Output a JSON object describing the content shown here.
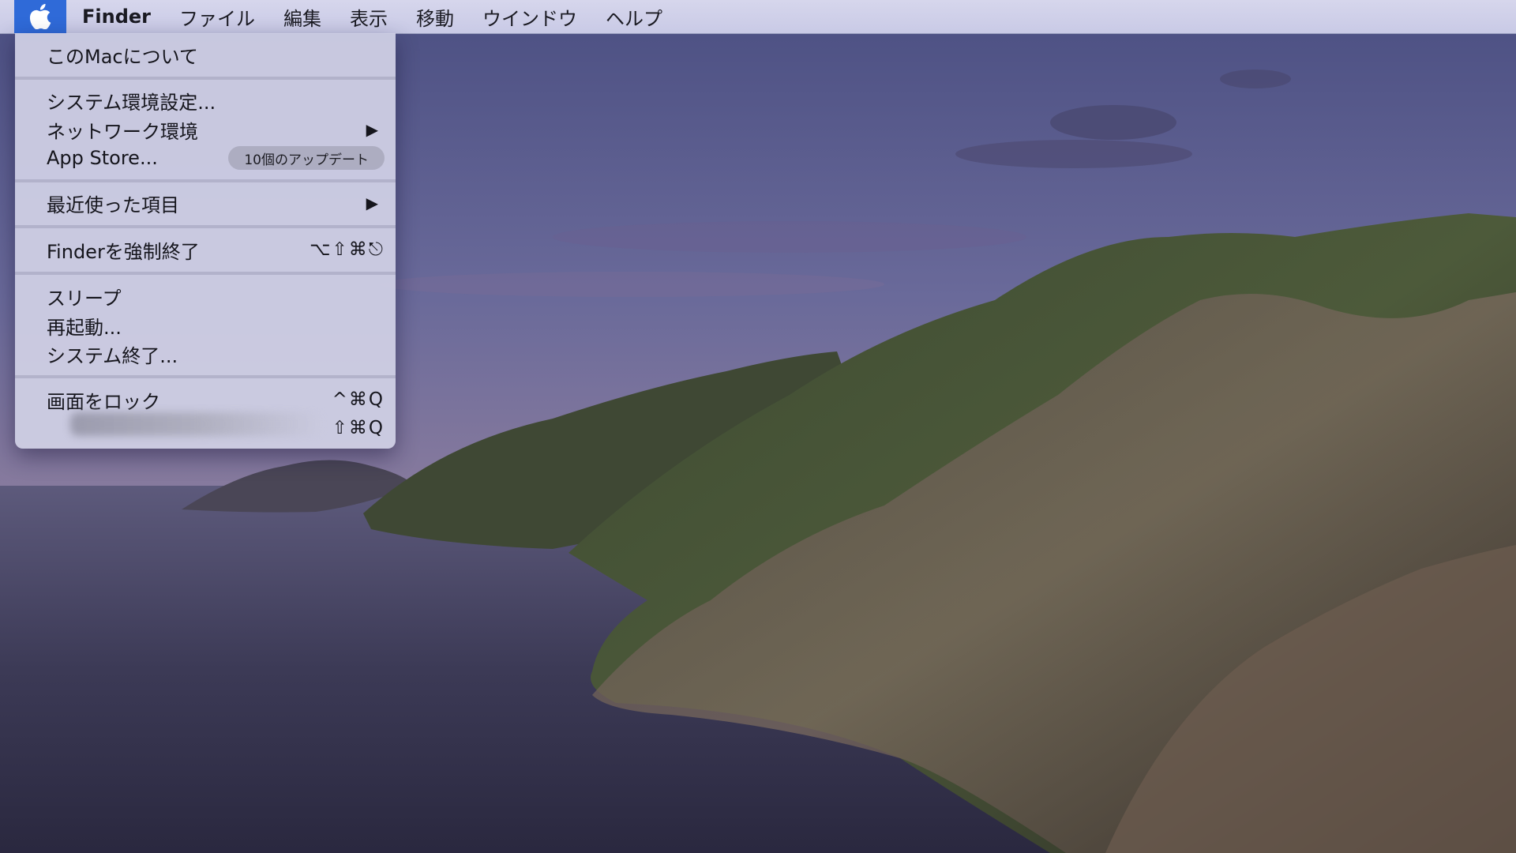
{
  "menubar": {
    "apple_icon": "apple-logo-icon",
    "app_name": "Finder",
    "menus": [
      "ファイル",
      "編集",
      "表示",
      "移動",
      "ウインドウ",
      "ヘルプ"
    ]
  },
  "apple_menu": {
    "about": "このMacについて",
    "system_prefs": "システム環境設定...",
    "network": "ネットワーク環境",
    "app_store": "App Store...",
    "app_store_badge": "10個のアップデート",
    "recent_items": "最近使った項目",
    "force_quit": "Finderを強制終了",
    "force_quit_shortcut": "⌥⇧⌘⎋",
    "sleep": "スリープ",
    "restart": "再起動...",
    "shutdown": "システム終了...",
    "lock_screen": "画面をロック",
    "lock_shortcut": "^⌘Q",
    "logout_shortcut": "⇧⌘Q",
    "submenu_arrow": "▶"
  },
  "colors": {
    "highlight": "#2f6ad8",
    "menubar": "#cfd0e8"
  }
}
